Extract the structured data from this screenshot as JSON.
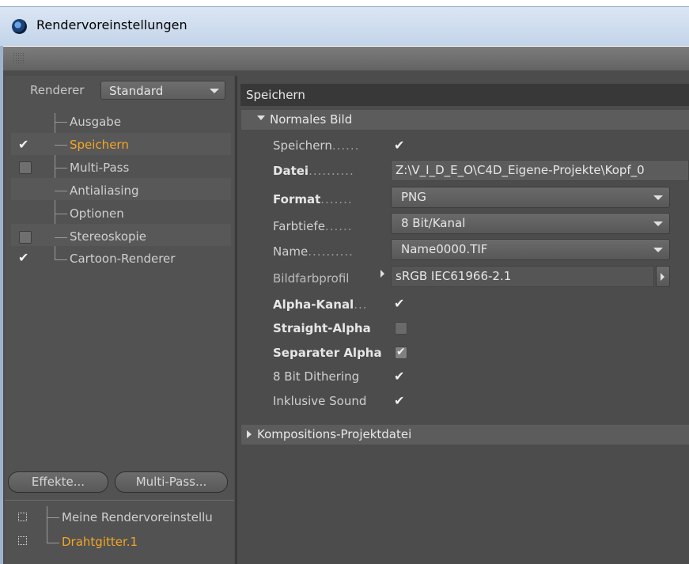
{
  "window": {
    "title": "Rendervoreinstellungen",
    "logo_icon": "cinema4d-logo-icon"
  },
  "left": {
    "renderer_label": "Renderer",
    "renderer_value": "Standard",
    "items": [
      {
        "label": "Ausgabe",
        "checkbox": "none"
      },
      {
        "label": "Speichern",
        "checkbox": "checked",
        "active": true
      },
      {
        "label": "Multi-Pass",
        "checkbox": "unchecked"
      },
      {
        "label": "Antialiasing",
        "checkbox": "none"
      },
      {
        "label": "Optionen",
        "checkbox": "none"
      },
      {
        "label": "Stereoskopie",
        "checkbox": "unchecked"
      },
      {
        "label": "Cartoon-Renderer",
        "checkbox": "checked"
      }
    ],
    "effects_button": "Effekte...",
    "multipass_button": "Multi-Pass...",
    "settings": [
      {
        "label": "Meine Rendervoreinstellu"
      },
      {
        "label": "Drahtgitter.1",
        "active": true
      }
    ]
  },
  "right": {
    "section_title": "Speichern",
    "subsection_open": "Normales Bild",
    "fields": {
      "speichern": {
        "label": "Speichern",
        "dots": "......"
      },
      "datei": {
        "label": "Datei",
        "dots": "..........",
        "value": "Z:\\V_I_D_E_O\\C4D_Eigene-Projekte\\Kopf_0"
      },
      "format": {
        "label": "Format",
        "dots": ".......",
        "value": "PNG"
      },
      "farbtiefe": {
        "label": "Farbtiefe",
        "dots": "......",
        "value": "8 Bit/Kanal"
      },
      "name": {
        "label": "Name",
        "dots": "..........",
        "value": "Name0000.TIF"
      },
      "bildfarbprofil": {
        "label": "Bildfarbprofil",
        "value": "sRGB IEC61966-2.1"
      },
      "alpha": {
        "label": "Alpha-Kanal",
        "dots": "..."
      },
      "straight_alpha": {
        "label": "Straight-Alpha"
      },
      "separater_alpha": {
        "label": "Separater Alpha"
      },
      "dithering": {
        "label": "8 Bit Dithering"
      },
      "sound": {
        "label": "Inklusive Sound"
      }
    },
    "subsection_closed": "Kompositions-Projektdatei"
  },
  "colors": {
    "accent": "#f5a623",
    "panel_bg": "#4c4c4c"
  }
}
